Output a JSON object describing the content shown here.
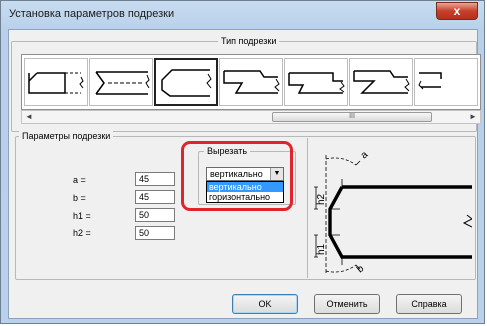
{
  "window": {
    "title": "Установка параметров подрезки",
    "close_glyph": "x"
  },
  "cut_type": {
    "legend": "Тип подрезки",
    "selected_index": 2
  },
  "scroll": {
    "thumb_grip": "III",
    "left_arrow": "◄",
    "right_arrow": "►"
  },
  "params": {
    "legend": "Параметры подрезки",
    "fields": [
      {
        "label": "a =",
        "value": "45"
      },
      {
        "label": "b =",
        "value": "45"
      },
      {
        "label": "h1 =",
        "value": "50"
      },
      {
        "label": "h2 =",
        "value": "50"
      }
    ]
  },
  "cut_dir": {
    "legend": "Вырезать",
    "selected": "вертикально",
    "options": [
      "вертикально",
      "горизонтально"
    ],
    "highlighted_index": 0
  },
  "diagram_labels": {
    "a": "a",
    "b": "b",
    "h1": "h1",
    "h2": "h2"
  },
  "buttons": {
    "ok": "OK",
    "cancel": "Отменить",
    "help": "Справка"
  },
  "colors": {
    "highlight": "#e0242b",
    "selection": "#3399ff"
  }
}
